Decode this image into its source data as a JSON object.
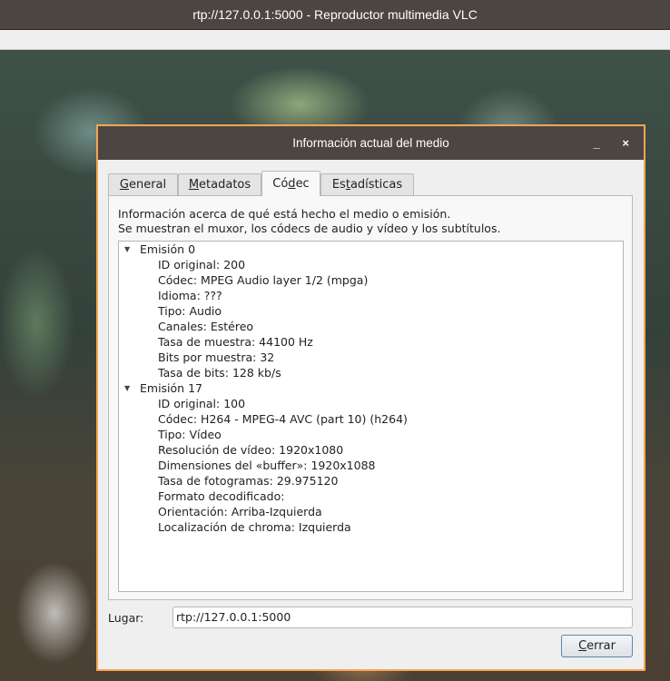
{
  "window": {
    "title": "rtp://127.0.0.1:5000 - Reproductor multimedia VLC"
  },
  "dialog": {
    "title": "Información actual del medio",
    "minimize_label": "_",
    "close_label": "×",
    "tabs": [
      {
        "pre": "",
        "u": "G",
        "post": "eneral",
        "active": false
      },
      {
        "pre": "",
        "u": "M",
        "post": "etadatos",
        "active": false
      },
      {
        "pre": "Có",
        "u": "d",
        "post": "ec",
        "active": true
      },
      {
        "pre": "Es",
        "u": "t",
        "post": "adísticas",
        "active": false
      }
    ],
    "description_line1": "Información acerca de qué está hecho el medio o emisión.",
    "description_line2": "Se muestran el muxor, los códecs de audio y vídeo y los subtítulos.",
    "streams": [
      {
        "name": "Emisión 0",
        "props": [
          "ID original: 200",
          "Códec: MPEG Audio layer 1/2 (mpga)",
          "Idioma: ???",
          "Tipo: Audio",
          "Canales: Estéreo",
          "Tasa de muestra: 44100 Hz",
          "Bits por muestra: 32",
          "Tasa de bits: 128 kb/s"
        ]
      },
      {
        "name": "Emisión 17",
        "props": [
          "ID original: 100",
          "Códec: H264 - MPEG-4 AVC (part 10) (h264)",
          "Tipo: Vídeo",
          "Resolución de vídeo: 1920x1080",
          "Dimensiones del «buffer»: 1920x1088",
          "Tasa de fotogramas: 29.975120",
          "Formato decodificado:",
          "Orientación: Arriba-Izquierda",
          "Localización de chroma: Izquierda"
        ]
      }
    ],
    "location_label": "Lugar:",
    "location_value": "rtp://127.0.0.1:5000",
    "close_button": {
      "u": "C",
      "post": "errar"
    }
  }
}
